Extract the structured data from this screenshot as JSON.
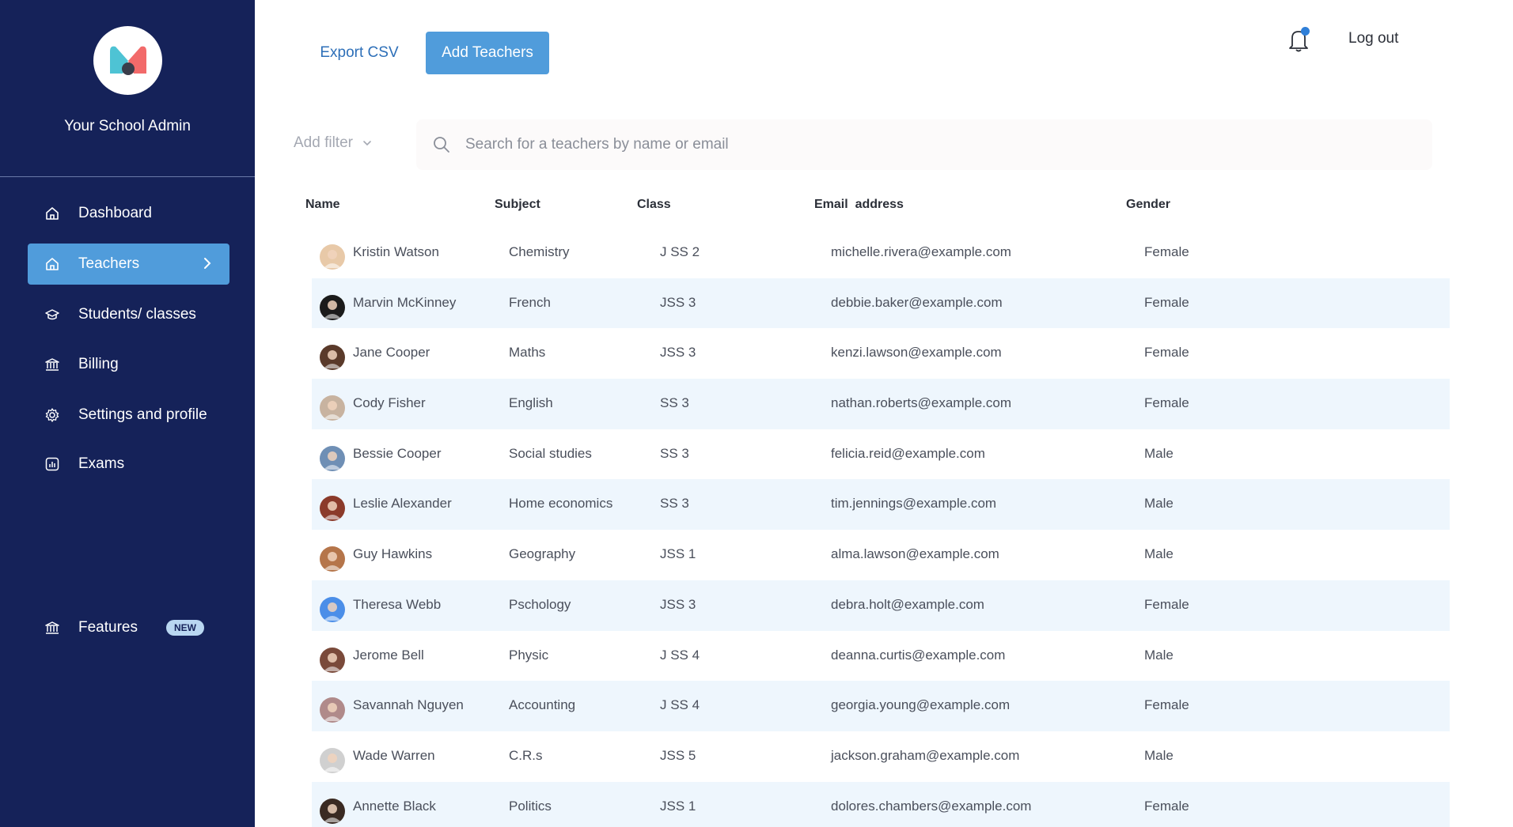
{
  "app": {
    "brand_name": "Your School Admin"
  },
  "sidebar": {
    "items": [
      {
        "label": "Dashboard",
        "icon": "home-icon",
        "active": false
      },
      {
        "label": "Teachers",
        "icon": "home-icon",
        "active": true
      },
      {
        "label": "Students/ classes",
        "icon": "graduation-cap-icon",
        "active": false
      },
      {
        "label": "Billing",
        "icon": "bank-icon",
        "active": false
      },
      {
        "label": "Settings and profile",
        "icon": "gear-icon",
        "active": false
      },
      {
        "label": "Exams",
        "icon": "chart-icon",
        "active": false
      }
    ],
    "features": {
      "label": "Features",
      "badge": "NEW",
      "icon": "bank-icon"
    }
  },
  "toolbar": {
    "export_label": "Export CSV",
    "add_label": "Add Teachers",
    "logout_label": "Log out"
  },
  "filter": {
    "label": "Add filter"
  },
  "search": {
    "placeholder": "Search for a teachers by name or email"
  },
  "table": {
    "columns": [
      "Name",
      "Subject",
      "Class",
      "Email  address",
      "Gender"
    ],
    "rows": [
      {
        "name": "Kristin Watson",
        "subject": "Chemistry",
        "class": "J SS 2",
        "email": "michelle.rivera@example.com",
        "gender": "Female"
      },
      {
        "name": "Marvin McKinney",
        "subject": "French",
        "class": "JSS 3",
        "email": "debbie.baker@example.com",
        "gender": "Female"
      },
      {
        "name": "Jane Cooper",
        "subject": "Maths",
        "class": "JSS 3",
        "email": "kenzi.lawson@example.com",
        "gender": "Female"
      },
      {
        "name": "Cody Fisher",
        "subject": "English",
        "class": "SS 3",
        "email": "nathan.roberts@example.com",
        "gender": "Female"
      },
      {
        "name": "Bessie Cooper",
        "subject": "Social studies",
        "class": "SS 3",
        "email": "felicia.reid@example.com",
        "gender": "Male"
      },
      {
        "name": "Leslie Alexander",
        "subject": "Home economics",
        "class": "SS 3",
        "email": "tim.jennings@example.com",
        "gender": "Male"
      },
      {
        "name": "Guy Hawkins",
        "subject": "Geography",
        "class": "JSS 1",
        "email": "alma.lawson@example.com",
        "gender": "Male"
      },
      {
        "name": "Theresa Webb",
        "subject": "Pschology",
        "class": "JSS 3",
        "email": "debra.holt@example.com",
        "gender": "Female"
      },
      {
        "name": "Jerome Bell",
        "subject": "Physic",
        "class": "J SS 4",
        "email": "deanna.curtis@example.com",
        "gender": "Male"
      },
      {
        "name": "Savannah Nguyen",
        "subject": "Accounting",
        "class": "J SS 4",
        "email": "georgia.young@example.com",
        "gender": "Female"
      },
      {
        "name": "Wade Warren",
        "subject": "C.R.s",
        "class": "JSS 5",
        "email": "jackson.graham@example.com",
        "gender": "Male"
      },
      {
        "name": "Annette Black",
        "subject": "Politics",
        "class": "JSS 1",
        "email": "dolores.chambers@example.com",
        "gender": "Female"
      }
    ]
  },
  "colors": {
    "sidebar_bg": "#152259",
    "accent": "#509cdb",
    "row_alt": "#eef6fd",
    "link": "#2d6fb8"
  }
}
